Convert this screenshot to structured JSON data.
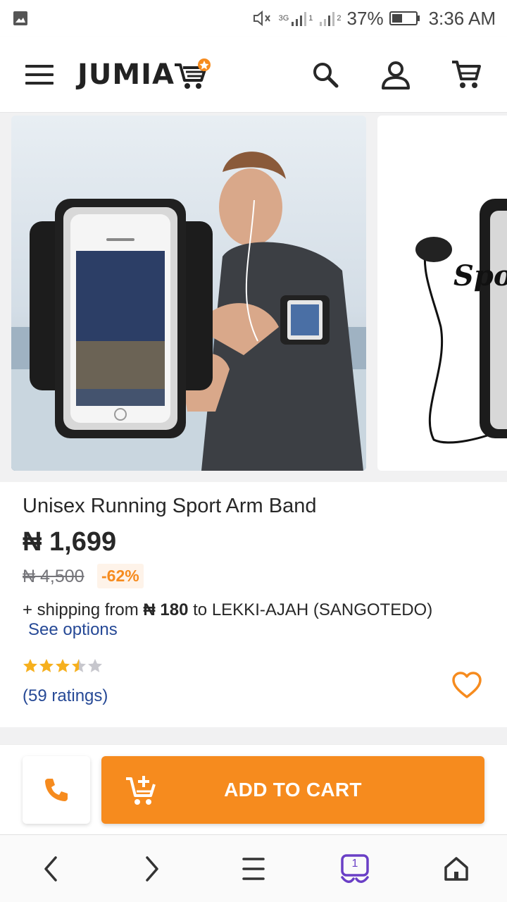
{
  "status_bar": {
    "signal_label": "3G",
    "sim1": "1",
    "sim2": "2",
    "battery": "37%",
    "time": "3:36 AM"
  },
  "header": {
    "logo_text": "JUMIA",
    "icons": [
      "menu-icon",
      "search-icon",
      "account-icon",
      "cart-icon"
    ]
  },
  "gallery": {
    "next_slide_caption": "Spor"
  },
  "product": {
    "title": "Unisex Running Sport Arm Band",
    "price": "₦ 1,699",
    "old_price": "₦ 4,500",
    "discount": "-62%",
    "shipping_prefix": "+ shipping from ",
    "shipping_amount": "₦ 180",
    "shipping_suffix": " to LEKKI-AJAH (SANGOTEDO)",
    "see_options": "See options",
    "rating": 3.5,
    "rating_max": 5,
    "ratings_count": "(59 ratings)"
  },
  "actions": {
    "add_to_cart": "ADD TO CART"
  },
  "browser_nav": {
    "tabs_count": "1"
  },
  "colors": {
    "accent": "#f68b1e",
    "link": "#264996",
    "text": "#282828",
    "star_filled": "#f6b01e",
    "star_empty": "#c7c7cd"
  }
}
